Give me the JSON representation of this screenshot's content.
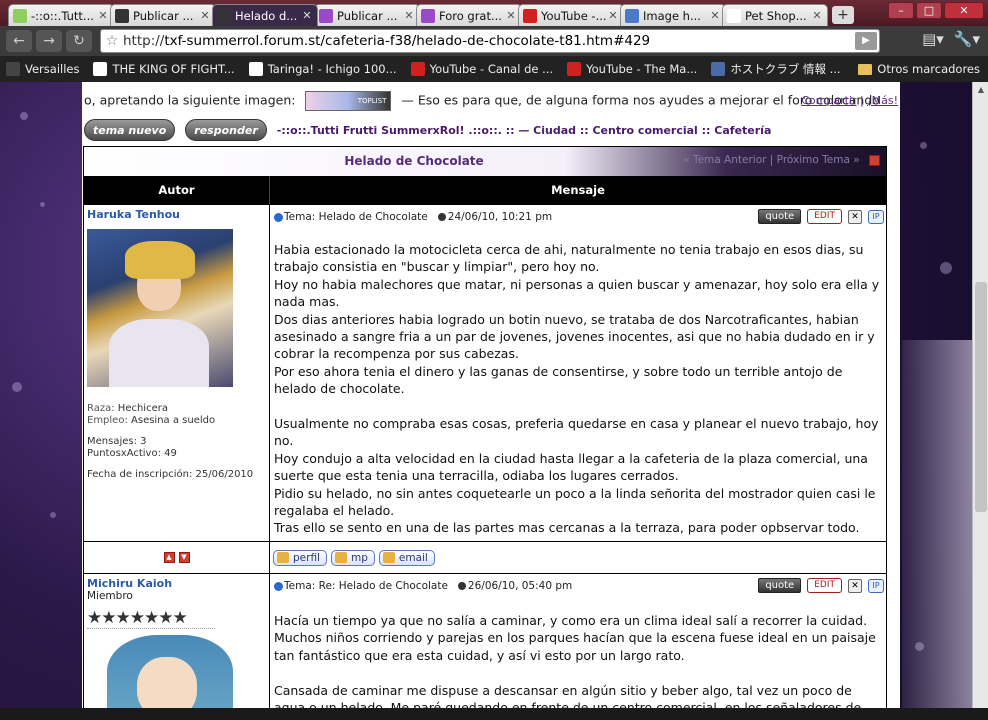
{
  "browser": {
    "tabs": [
      {
        "title": "-::o::.Tutt...",
        "color": "#8fcf5f",
        "icon": "speech-bubble-icon"
      },
      {
        "title": "Publicar ...",
        "color": "#333333",
        "icon": "checker-icon"
      },
      {
        "title": "Helado d...",
        "color": "#333333",
        "icon": "checker-icon",
        "active": true
      },
      {
        "title": "Publicar ...",
        "color": "#9a4ac8",
        "icon": "feather-icon"
      },
      {
        "title": "Foro grat...",
        "color": "#9a4ac8",
        "icon": "feather-icon"
      },
      {
        "title": "YouTube -...",
        "color": "#d02020",
        "icon": "youtube-icon"
      },
      {
        "title": "Image h...",
        "color": "#4a7ac8",
        "icon": "image-icon"
      },
      {
        "title": "Pet Shop...",
        "color": "#ffffff",
        "icon": "page-icon"
      }
    ],
    "new_tab": "+",
    "url_prefix": "http://",
    "url": "txf-summerrol.forum.st/cafeteria-f38/helado-de-chocolate-t81.htm#429",
    "bookmarks": [
      {
        "label": "Versailles",
        "color": "#444444"
      },
      {
        "label": "THE KING OF FIGHT...",
        "color": "#ffffff"
      },
      {
        "label": "Taringa! - Ichigo 100...",
        "color": "#ffffff"
      },
      {
        "label": "YouTube - Canal de ...",
        "color": "#d02020"
      },
      {
        "label": "YouTube - The Ma...",
        "color": "#d02020"
      },
      {
        "label": "ホストクラブ 情報 ...",
        "color": "#4a6aa8"
      }
    ],
    "other_bookmarks": "Otros marcadores"
  },
  "forum": {
    "intro_before": "o, apretando la siguiente imagen:",
    "intro_after": "— Eso es para que, de alguna forma nos ayudes a mejorar el foro colocando",
    "toplist_label": "TOPLIST",
    "new_topic_btn": "tema nuevo",
    "reply_btn": "responder",
    "breadcrumb": "-::o::.Tutti Frutti SummerxRol! .::o::. :: — Ciudad :: Centro comercial :: Cafetería",
    "share": "Compartir",
    "more": "¡Más!",
    "topic_title": "Helado de Chocolate",
    "prev_topic": "« Tema Anterior",
    "next_topic": "Próximo Tema »",
    "col_author": "Autor",
    "col_message": "Mensaje",
    "quote_label": "quote",
    "edit_label": "EDIT",
    "ip_label": "IP",
    "profile_label": "perfil",
    "mp_label": "mp",
    "email_label": "email"
  },
  "posts": [
    {
      "author": "Haruka Tenhou",
      "raza_label": "Raza:",
      "raza": "Hechicera",
      "empleo_label": "Empleo:",
      "empleo": "Asesina a sueldo",
      "mensajes": "Mensajes: 3",
      "puntos": "PuntosxActivo: 49",
      "joined": "Fecha de inscripción: 25/06/2010",
      "topic": "Tema: Helado de Chocolate",
      "date": "24/06/10, 10:21 pm",
      "paragraphs": [
        "Habia estacionado la motocicleta cerca de ahi, naturalmente no tenia trabajo en esos dias, su trabajo consistia en \"buscar y limpiar\", pero hoy no.",
        "Hoy no habia malechores que matar, ni personas a quien buscar y amenazar, hoy solo era ella y nada mas.",
        "Dos dias anteriores habia logrado un botin nuevo, se trataba de dos Narcotraficantes, habian asesinado a sangre fria a un par de jovenes, jovenes inocentes, asi que no habia dudado en ir y cobrar la recompenza por sus cabezas.",
        "Por eso ahora tenia el dinero y las ganas de consentirse, y sobre todo un terrible antojo de helado de chocolate.",
        "",
        "Usualmente no compraba esas cosas, preferia quedarse en casa y planear el nuevo trabajo, hoy no.",
        "Hoy condujo a alta velocidad en la ciudad hasta llegar a la cafeteria de la plaza comercial, una suerte que esta tenia una terracilla, odiaba los lugares cerrados.",
        "Pidio su helado, no sin antes coquetearle un poco a la linda señorita del mostrador quien casi le regalaba el helado.",
        "Tras ello se sento en una de las partes mas cercanas a la terraza, para poder opbservar todo."
      ]
    },
    {
      "author": "Michiru Kaioh",
      "rank": "Miembro",
      "stars": "★★★★★★★",
      "topic": "Tema: Re: Helado de Chocolate",
      "date": "26/06/10, 05:40 pm",
      "paragraphs": [
        "Hacía un tiempo ya que no salía a caminar, y como era un clima ideal salí a recorrer la cuidad.",
        "Muchos niños corriendo y parejas en los parques hacían que la escena fuese ideal en un paisaje tan fantástico que era esta cuidad, y así vi esto por un largo rato.",
        "",
        "Cansada de caminar me dispuse a descansar en algún sitio y beber algo, tal vez un poco de agua o un helado. Me paré quedando en frente de un centro comercial, en los señaladores de este que"
      ]
    }
  ]
}
